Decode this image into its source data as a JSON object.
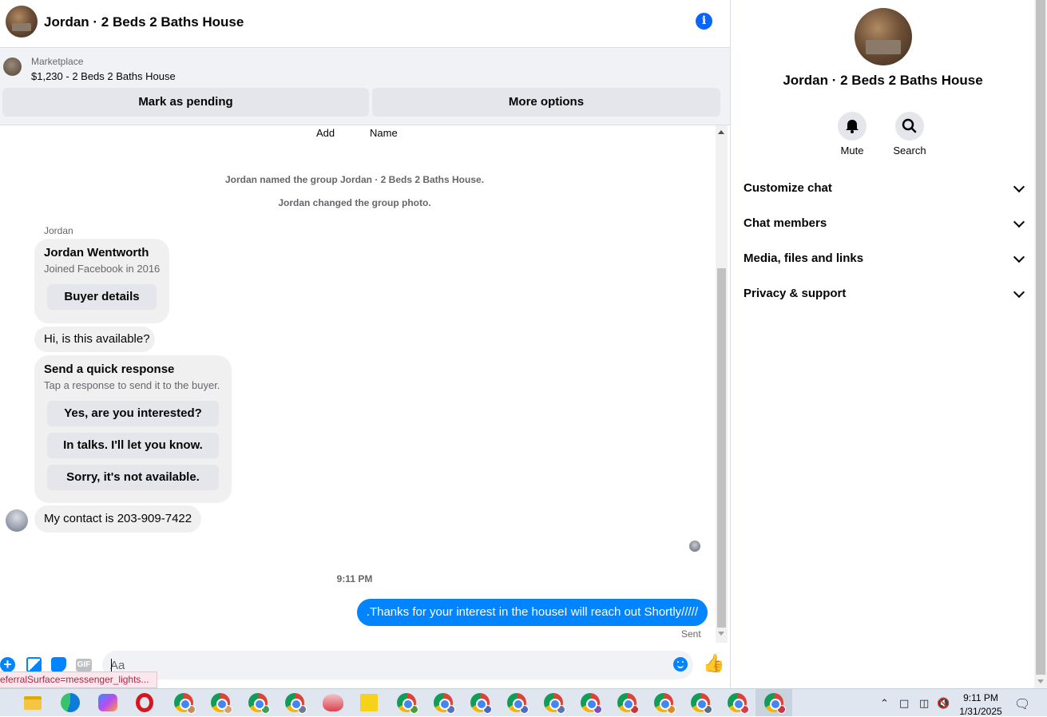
{
  "header": {
    "title": "Jordan · 2 Beds 2 Baths House"
  },
  "marketplace": {
    "label": "Marketplace",
    "listing": "$1,230 - 2 Beds 2 Baths House",
    "pending_button": "Mark as pending",
    "more_button": "More options"
  },
  "conversation": {
    "top_actions": [
      "Add",
      "Name"
    ],
    "system_messages": [
      "Jordan named the group Jordan · 2 Beds 2 Baths House.",
      "Jordan changed the group photo."
    ],
    "sender_name": "Jordan",
    "profile_card": {
      "name": "Jordan Wentworth",
      "joined": "Joined Facebook in 2016",
      "button": "Buyer details"
    },
    "incoming_1": "Hi, is this available?",
    "quick_response": {
      "title": "Send a quick response",
      "subtitle": "Tap a response to send it to the buyer.",
      "options": [
        "Yes, are you interested?",
        "In talks. I'll let you know.",
        "Sorry, it's not available."
      ]
    },
    "incoming_2": "My contact is 203-909-7422",
    "timestamp": "9:11 PM",
    "outgoing": ".Thanks for your interest in the houseI will reach out Shortly/////",
    "sent_status": "Sent"
  },
  "composer": {
    "placeholder": "Aa",
    "gif_label": "GIF"
  },
  "status_url": "eferralSurface=messenger_lights...",
  "right_panel": {
    "title": "Jordan · 2 Beds 2 Baths House",
    "mute_label": "Mute",
    "search_label": "Search",
    "sections": [
      "Customize chat",
      "Chat members",
      "Media, files and links",
      "Privacy & support"
    ]
  },
  "taskbar": {
    "time": "9:11 PM",
    "date": "1/31/2025"
  },
  "colors": {
    "accent": "#0084ff",
    "info_icon": "#0866ff",
    "bubble_grey": "#f0f0f0"
  }
}
